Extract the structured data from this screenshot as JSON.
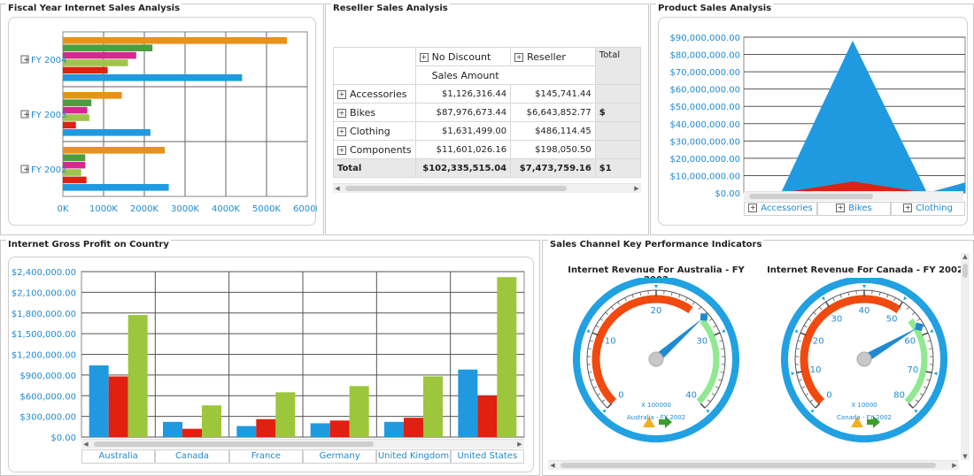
{
  "fiscal": {
    "title": "Fiscal Year Internet Sales Analysis",
    "years": [
      "FY 2004",
      "FY 2003",
      "FY 2002"
    ],
    "xticks": [
      "0K",
      "1000K",
      "2000K",
      "3000K",
      "4000K",
      "5000K",
      "6000K"
    ]
  },
  "reseller": {
    "title": "Reseller Sales Analysis",
    "col_headers": [
      "No Discount",
      "Reseller",
      "Total"
    ],
    "measure": "Sales Amount",
    "rows": [
      {
        "label": "Accessories",
        "v1": "$1,126,316.44",
        "v2": "$145,741.44"
      },
      {
        "label": "Bikes",
        "v1": "$87,976,673.44",
        "v2": "$6,643,852.77",
        "v3": "$"
      },
      {
        "label": "Clothing",
        "v1": "$1,631,499.00",
        "v2": "$486,114.45"
      },
      {
        "label": "Components",
        "v1": "$11,601,026.16",
        "v2": "$198,050.50"
      }
    ],
    "total": {
      "label": "Total",
      "v1": "$102,335,515.04",
      "v2": "$7,473,759.16",
      "v3": "$1"
    }
  },
  "product": {
    "title": "Product Sales Analysis",
    "yticks": [
      "$90,000,000.00",
      "$80,000,000.00",
      "$70,000,000.00",
      "$60,000,000.00",
      "$50,000,000.00",
      "$40,000,000.00",
      "$30,000,000.00",
      "$20,000,000.00",
      "$10,000,000.00",
      "$0.00"
    ],
    "categories": [
      "Accessories",
      "Bikes",
      "Clothing"
    ]
  },
  "gross": {
    "title": "Internet Gross Profit on Country",
    "yticks": [
      "$2,400,000.00",
      "$2,100,000.00",
      "$1,800,000.00",
      "$1,500,000.00",
      "$1,200,000.00",
      "$900,000.00",
      "$600,000.00",
      "$300,000.00",
      "$0.00"
    ],
    "countries": [
      "Australia",
      "Canada",
      "France",
      "Germany",
      "United Kingdom",
      "United States"
    ]
  },
  "kpi": {
    "title": "Sales Channel Key Performance Indicators",
    "gauges": [
      {
        "title": "Internet Revenue For Australia - FY 2002",
        "multiplier": "X 100000",
        "caption": "Australia - FY 2002",
        "labels": [
          "0",
          "10",
          "20",
          "30",
          "40"
        ]
      },
      {
        "title": "Internet Revenue For Canada - FY 2002",
        "multiplier": "X 10000",
        "caption": "Canada - FY 2002",
        "labels": [
          "0",
          "10",
          "20",
          "30",
          "40",
          "50",
          "60",
          "70",
          "80"
        ]
      }
    ]
  },
  "chart_data": [
    {
      "type": "bar",
      "title": "Fiscal Year Internet Sales Analysis",
      "orientation": "horizontal",
      "categories": [
        "FY 2004",
        "FY 2003",
        "FY 2002"
      ],
      "xlim": [
        0,
        6000
      ],
      "series": [
        {
          "color": "#e8921a",
          "values": [
            5500,
            1450,
            2500
          ]
        },
        {
          "color": "#4a9e3f",
          "values": [
            2200,
            700,
            550
          ]
        },
        {
          "color": "#d6288f",
          "values": [
            1800,
            600,
            550
          ]
        },
        {
          "color": "#9cc64a",
          "values": [
            1600,
            650,
            450
          ]
        },
        {
          "color": "#e02010",
          "values": [
            1100,
            320,
            580
          ]
        },
        {
          "color": "#1f9ae0",
          "values": [
            4400,
            2150,
            2600
          ]
        }
      ]
    },
    {
      "type": "area",
      "title": "Product Sales Analysis",
      "categories": [
        "Accessories",
        "Bikes",
        "Clothing"
      ],
      "ylim": [
        0,
        90000000
      ],
      "series": [
        {
          "color": "#1f9ae0",
          "values": [
            0,
            88000000,
            0,
            6000000
          ]
        },
        {
          "color": "#e02010",
          "values": [
            0,
            6600000,
            0,
            0
          ]
        }
      ]
    },
    {
      "type": "bar",
      "title": "Internet Gross Profit on Country",
      "categories": [
        "Australia",
        "Canada",
        "France",
        "Germany",
        "United Kingdom",
        "United States"
      ],
      "ylim": [
        0,
        2400000
      ],
      "series": [
        {
          "color": "#1f9ae0",
          "values": [
            1040000,
            220000,
            160000,
            200000,
            220000,
            980000
          ]
        },
        {
          "color": "#e02010",
          "values": [
            880000,
            120000,
            260000,
            240000,
            280000,
            600000
          ]
        },
        {
          "color": "#9cc63c",
          "values": [
            1770000,
            460000,
            650000,
            740000,
            880000,
            2320000
          ]
        }
      ]
    }
  ]
}
